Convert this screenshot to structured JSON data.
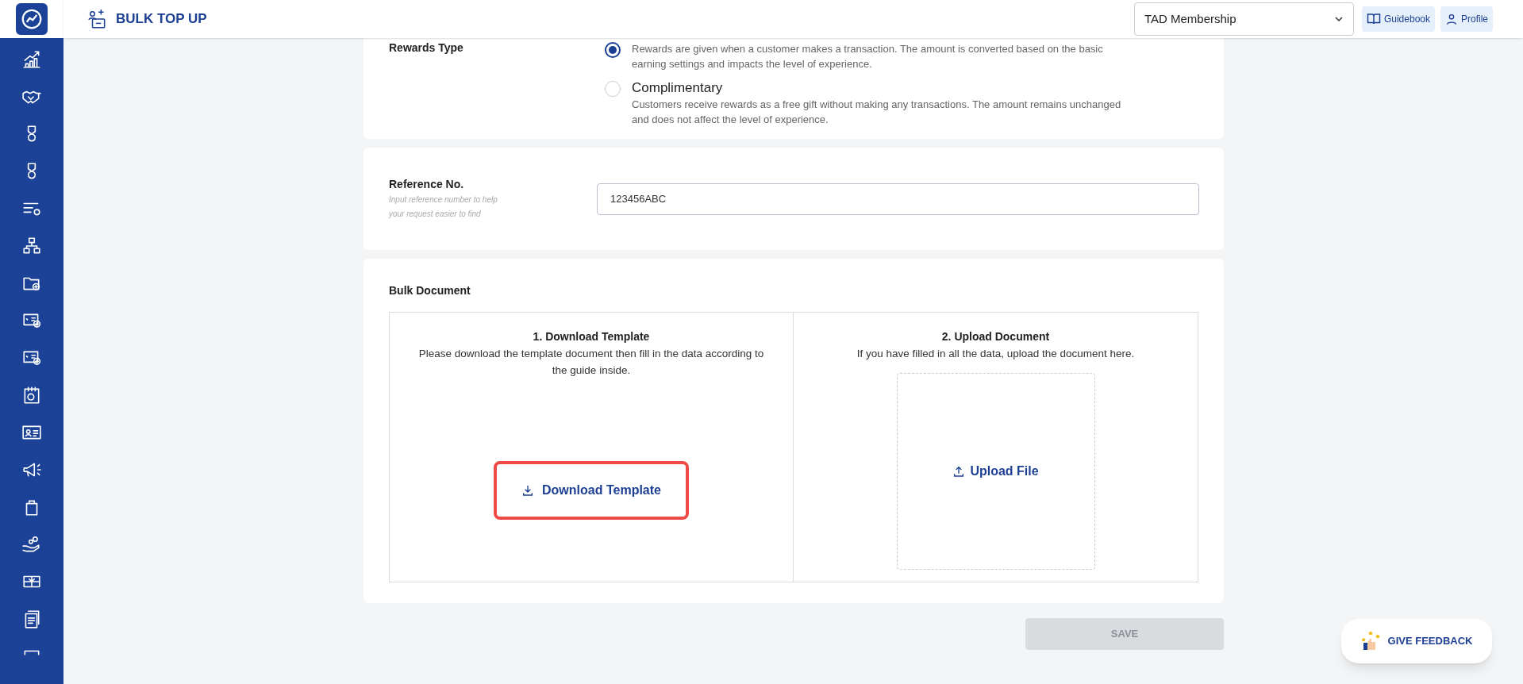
{
  "header": {
    "title": "BULK TOP UP",
    "program_select": {
      "value": "TAD Membership"
    },
    "buttons": [
      {
        "kind": "guide",
        "label": "Guidebook"
      },
      {
        "kind": "profile",
        "label": "Profile"
      }
    ]
  },
  "rewards_type": {
    "label": "Rewards Type",
    "options": [
      {
        "description": "Rewards are given when a customer makes a transaction. The amount is converted based on the basic earning settings and impacts the level of experience.",
        "selected": true
      },
      {
        "title": "Complimentary",
        "description": "Customers receive rewards as a free gift without making any transactions. The amount remains unchanged and does not affect the level of experience.",
        "selected": false
      }
    ]
  },
  "reference": {
    "label": "Reference No.",
    "hint": "Input reference number to help your request easier to find",
    "value": "123456ABC"
  },
  "bulk_document": {
    "title": "Bulk Document",
    "steps": [
      {
        "kind": "download",
        "title": "1. Download Template",
        "description": "Please download the template document then fill in the data according to the guide inside.",
        "button": "Download Template",
        "highlighted": true
      },
      {
        "kind": "upload",
        "title": "2. Upload Document",
        "description": "If you have filled in all the data, upload the document here.",
        "button": "Upload File",
        "highlighted": false
      }
    ]
  },
  "save_button": {
    "label": "SAVE",
    "disabled": true
  },
  "feedback_button": {
    "label": "GIVE FEEDBACK"
  }
}
